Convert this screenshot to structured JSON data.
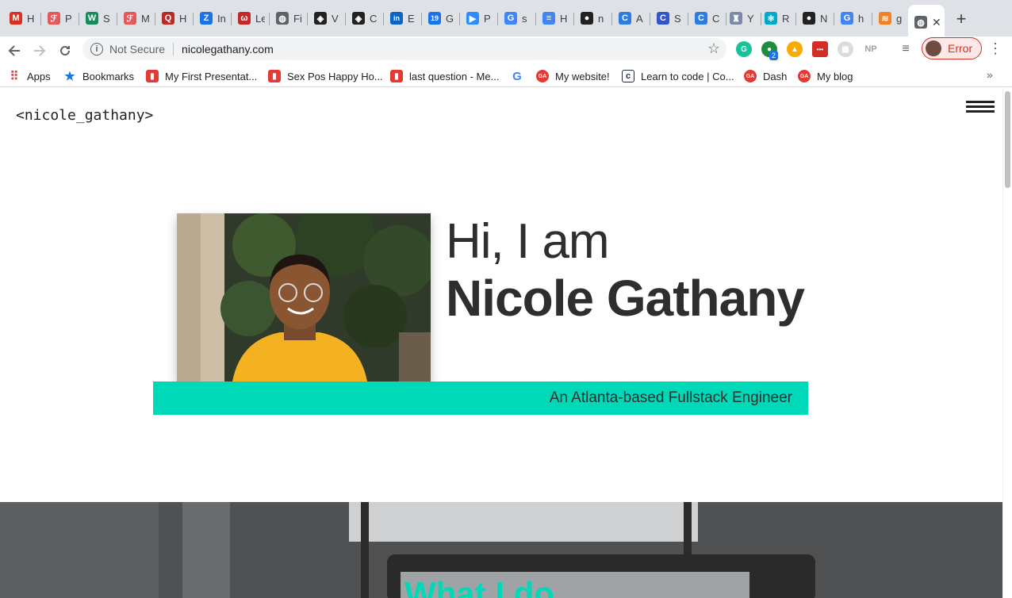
{
  "browser": {
    "tabs": [
      {
        "title": "H",
        "icon": "gmail-icon",
        "glyph": "M",
        "color": "#d93025"
      },
      {
        "title": "P",
        "icon": "gemini-icon",
        "glyph": "ℱ",
        "color": "#e8585b"
      },
      {
        "title": "S",
        "icon": "upwork-icon",
        "glyph": "W",
        "color": "#1b8a5a"
      },
      {
        "title": "M",
        "icon": "gemini-icon",
        "glyph": "ℱ",
        "color": "#e8585b"
      },
      {
        "title": "H",
        "icon": "quora-icon",
        "glyph": "Q",
        "color": "#b92b27"
      },
      {
        "title": "In",
        "icon": "zillow-icon",
        "glyph": "Z",
        "color": "#1a73e8"
      },
      {
        "title": "Le",
        "icon": "lever-icon",
        "glyph": "ω",
        "color": "#c62828"
      },
      {
        "title": "Fi",
        "icon": "globe-icon",
        "glyph": "◍",
        "color": "#5f6368"
      },
      {
        "title": "V",
        "icon": "codepen-icon",
        "glyph": "◈",
        "color": "#222222"
      },
      {
        "title": "C",
        "icon": "codepen-icon",
        "glyph": "◈",
        "color": "#222222"
      },
      {
        "title": "E",
        "icon": "linkedin-icon",
        "glyph": "in",
        "color": "#0a66c2"
      },
      {
        "title": "G",
        "icon": "calendar-icon",
        "glyph": "19",
        "color": "#1a73e8"
      },
      {
        "title": "P",
        "icon": "zoom-icon",
        "glyph": "▶",
        "color": "#2d8cff"
      },
      {
        "title": "s",
        "icon": "google-icon",
        "glyph": "G",
        "color": "#4285f4"
      },
      {
        "title": "H",
        "icon": "docs-icon",
        "glyph": "≡",
        "color": "#4285f4"
      },
      {
        "title": "n",
        "icon": "github-icon",
        "glyph": "●",
        "color": "#222222"
      },
      {
        "title": "A",
        "icon": "canva-icon",
        "glyph": "C",
        "color": "#2d7de0"
      },
      {
        "title": "S",
        "icon": "canva-icon",
        "glyph": "C",
        "color": "#3355cc"
      },
      {
        "title": "C",
        "icon": "canva-icon",
        "glyph": "C",
        "color": "#2d7de0"
      },
      {
        "title": "Y",
        "icon": "tower-icon",
        "glyph": "♜",
        "color": "#7a8aa8"
      },
      {
        "title": "R",
        "icon": "react-icon",
        "glyph": "⚛",
        "color": "#00a8cc"
      },
      {
        "title": "N",
        "icon": "github-icon",
        "glyph": "●",
        "color": "#222222"
      },
      {
        "title": "h",
        "icon": "google-icon",
        "glyph": "G",
        "color": "#4285f4"
      },
      {
        "title": "g",
        "icon": "stackoverflow-icon",
        "glyph": "≋",
        "color": "#f48024"
      }
    ],
    "active_tab_icon": "globe-icon",
    "address": {
      "security_label": "Not Secure",
      "url": "nicolegathany.com"
    },
    "profile": {
      "status": "Error"
    },
    "extensions": [
      {
        "name": "grammarly-icon",
        "glyph": "G",
        "color": "#15c39a"
      },
      {
        "name": "extension-badge-icon",
        "glyph": "●",
        "color": "#1e8e3e"
      },
      {
        "name": "warning-extension-icon",
        "glyph": "▲",
        "color": "#f9ab00"
      },
      {
        "name": "lastpass-icon",
        "glyph": "•••",
        "color": "#d32d27"
      },
      {
        "name": "extension-grid-icon",
        "glyph": "▦",
        "color": "#dadce0"
      },
      {
        "name": "np-extension-icon",
        "glyph": "NP",
        "color": "#9aa0a6"
      },
      {
        "name": "media-queue-icon",
        "glyph": "≡",
        "color": "#5f6368"
      }
    ],
    "extension_badge_count": "2",
    "bookmarks": [
      {
        "label": "Apps",
        "icon": "apps-grid-icon",
        "glyph": "⠿",
        "color": "#ea4335"
      },
      {
        "label": "Bookmarks",
        "icon": "star-icon",
        "glyph": "★",
        "color": "#1a73e8"
      },
      {
        "label": "My First Presentat...",
        "icon": "prezi-icon",
        "glyph": "▮",
        "color": "#e53935"
      },
      {
        "label": "Sex Pos Happy Ho...",
        "icon": "prezi-icon",
        "glyph": "▮",
        "color": "#e53935"
      },
      {
        "label": "last question - Me...",
        "icon": "prezi-icon",
        "glyph": "▮",
        "color": "#e53935"
      },
      {
        "label": "",
        "icon": "google-icon",
        "glyph": "G",
        "color": "#4285f4"
      },
      {
        "label": "My website!",
        "icon": "ga-icon",
        "glyph": "GA",
        "color": "#e53935"
      },
      {
        "label": "Learn to code | Co...",
        "icon": "codecademy-icon",
        "glyph": "c",
        "color": "#1f2b3d"
      },
      {
        "label": "Dash",
        "icon": "ga-icon",
        "glyph": "GA",
        "color": "#e53935"
      },
      {
        "label": "My blog",
        "icon": "ga-icon",
        "glyph": "GA",
        "color": "#e53935"
      }
    ]
  },
  "site": {
    "logo": "<nicole_gathany>",
    "greeting": "Hi, I am",
    "name": "Nicole Gathany",
    "tagline": "An Atlanta-based Fullstack Engineer",
    "section_title": "What I do",
    "accent_color": "#00d9b8"
  }
}
